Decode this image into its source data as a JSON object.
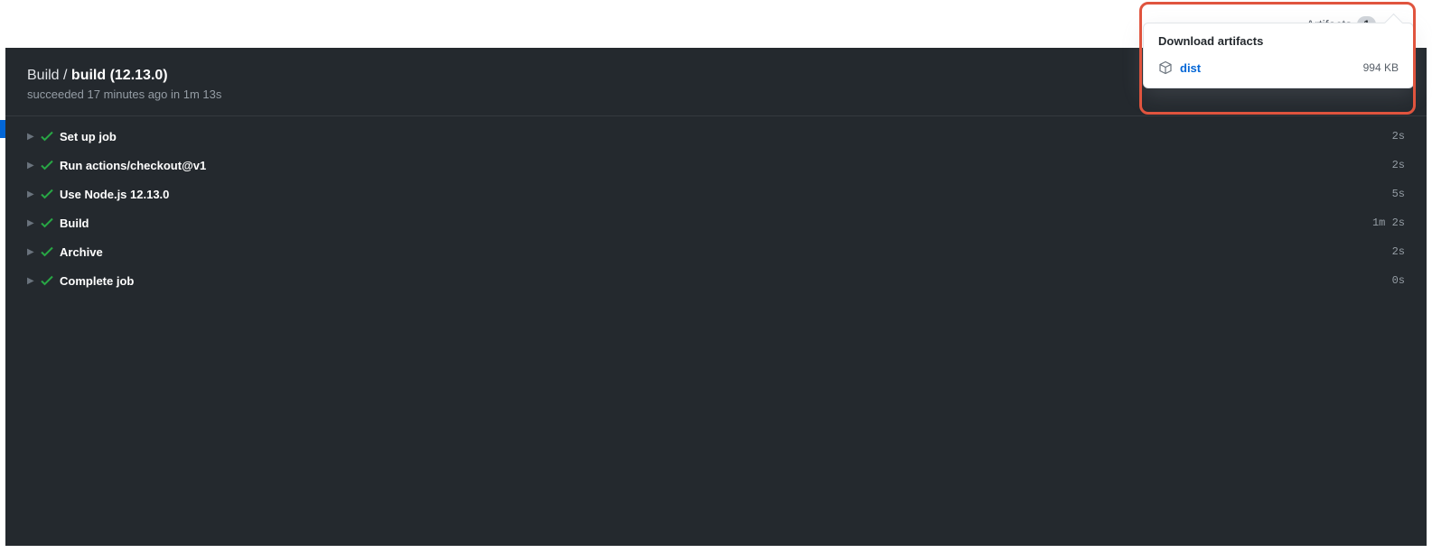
{
  "topbar": {
    "artifacts_label": "Artifacts",
    "artifacts_count": "1"
  },
  "header": {
    "workflow": "Build",
    "separator": " / ",
    "job": "build (12.13.0)",
    "status_line": "succeeded 17 minutes ago in 1m 13s"
  },
  "steps": [
    {
      "name": "Set up job",
      "duration": "2s"
    },
    {
      "name": "Run actions/checkout@v1",
      "duration": "2s"
    },
    {
      "name": "Use Node.js 12.13.0",
      "duration": "5s"
    },
    {
      "name": "Build",
      "duration": "1m 2s"
    },
    {
      "name": "Archive",
      "duration": "2s"
    },
    {
      "name": "Complete job",
      "duration": "0s"
    }
  ],
  "dropdown": {
    "title": "Download artifacts",
    "items": [
      {
        "name": "dist",
        "size": "994 KB"
      }
    ]
  }
}
